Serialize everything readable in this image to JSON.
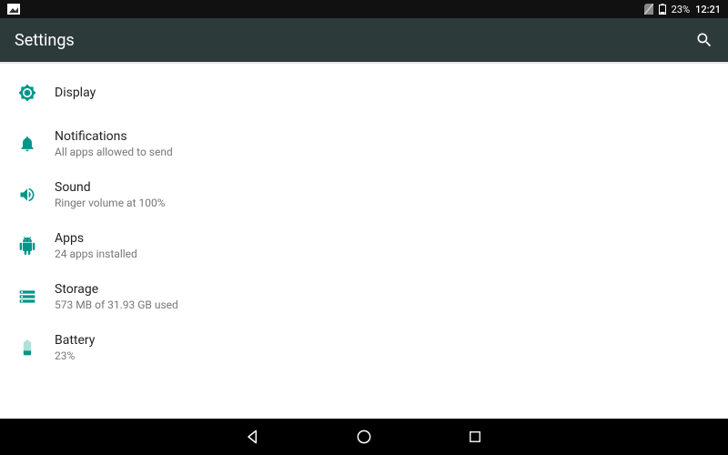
{
  "status_bar": {
    "battery_percent": "23%",
    "clock": "12:21"
  },
  "app_bar": {
    "title": "Settings"
  },
  "settings": [
    {
      "icon": "display",
      "label": "Display",
      "sub": ""
    },
    {
      "icon": "notifications",
      "label": "Notifications",
      "sub": "All apps allowed to send"
    },
    {
      "icon": "sound",
      "label": "Sound",
      "sub": "Ringer volume at 100%"
    },
    {
      "icon": "apps",
      "label": "Apps",
      "sub": "24 apps installed"
    },
    {
      "icon": "storage",
      "label": "Storage",
      "sub": "573 MB of 31.93 GB used"
    },
    {
      "icon": "battery",
      "label": "Battery",
      "sub": "23%"
    }
  ]
}
